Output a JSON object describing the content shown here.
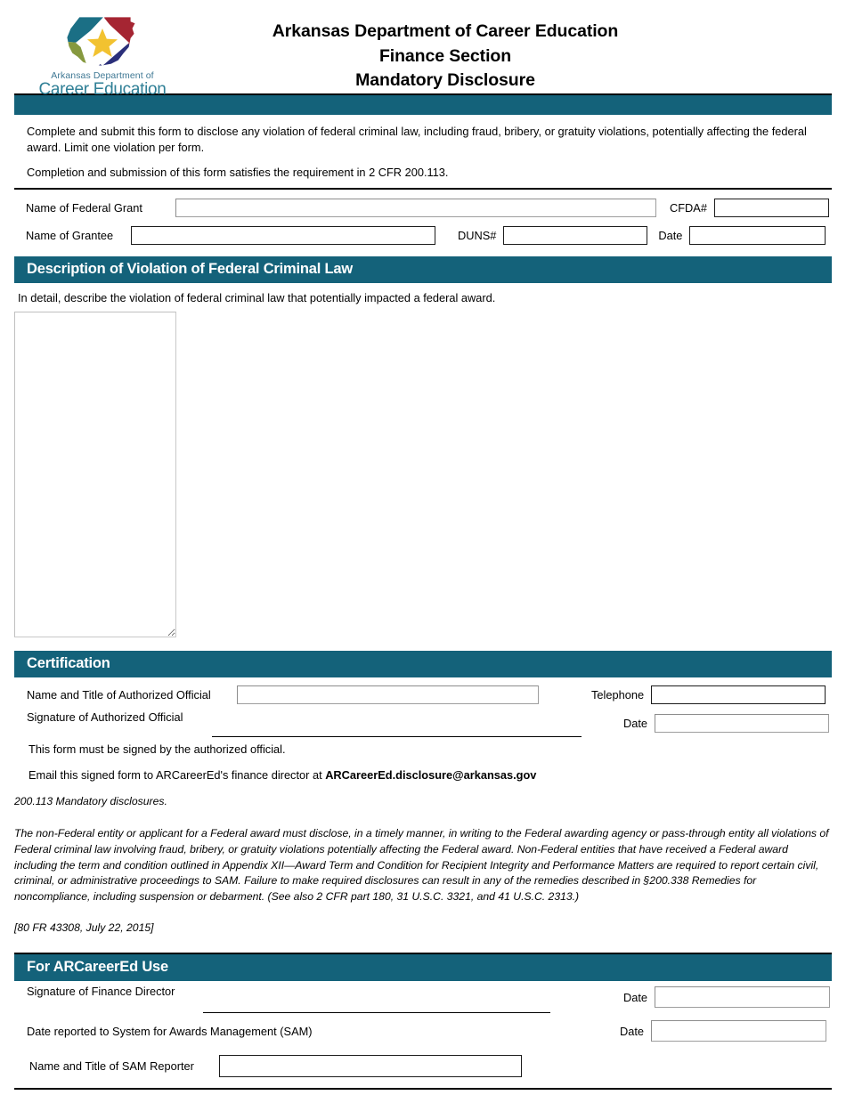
{
  "logo": {
    "line1": "Arkansas Department of",
    "line2": "Career Education",
    "icon": "arkansas-state-star-logo"
  },
  "header": {
    "title_line1": "Arkansas Department of Career Education",
    "title_line2": "Finance Section",
    "title_line3": "Mandatory  Disclosure"
  },
  "colors": {
    "teal": "#14627a",
    "logo_teal": "#2f7f96",
    "logo_red": "#a52532",
    "logo_green": "#86993f",
    "logo_navy": "#2b2f7a",
    "logo_star": "#f2c230"
  },
  "intro": {
    "paragraph1": "Complete and submit this form to disclose any violation of federal criminal law, including fraud, bribery, or gratuity violations, potentially affecting the federal award. Limit one violation per form.",
    "paragraph2": "Completion and submission of this form satisfies the requirement in 2 CFR 200.113."
  },
  "grant_fields": {
    "name_of_federal_grant_label": "Name of Federal Grant",
    "name_of_federal_grant_value": "",
    "cfda_label": "CFDA#",
    "cfda_value": "",
    "name_of_grantee_label": "Name of Grantee",
    "name_of_grantee_value": "",
    "duns_label": "DUNS#",
    "duns_value": "",
    "date_label": "Date",
    "date_value": ""
  },
  "description_section": {
    "heading": "Description of Violation of Federal Criminal Law",
    "instruction": "In detail, describe the violation of federal criminal law that potentially impacted a federal award.",
    "textarea_value": ""
  },
  "certification_section": {
    "heading": "Certification",
    "name_title_label": "Name and Title of Authorized Official",
    "name_title_value": "",
    "telephone_label": "Telephone",
    "telephone_value": "",
    "signature_label": "Signature of Authorized Official",
    "signature_value": "",
    "date_label": "Date",
    "date_value": "",
    "note_signed": "This form must be signed by the authorized official.",
    "email_prefix": "Email this signed form to ARCareerEd's finance director at ",
    "email_address": "ARCareerEd.disclosure@arkansas.gov"
  },
  "legal": {
    "lead": "200.113   Mandatory disclosures.",
    "body": "The non-Federal entity or applicant for a Federal award must disclose, in a timely manner, in writing to the Federal awarding agency or pass-through entity all violations of Federal criminal law involving fraud, bribery, or gratuity violations potentially affecting the Federal award. Non-Federal entities that have received a Federal award including the term and condition outlined in Appendix XII—Award Term and Condition for Recipient Integrity and Performance Matters are required to report certain civil, criminal, or administrative proceedings to SAM. Failure to make required disclosures can result in any of the remedies described in §200.338 Remedies for noncompliance, including suspension or debarment. (See also 2 CFR part 180, 31 U.S.C. 3321, and 41 U.S.C. 2313.)",
    "citation": "[80 FR 43308, July 22, 2015]"
  },
  "office_use_section": {
    "heading": "For ARCareerEd Use",
    "finance_director_signature_label": "Signature of Finance Director",
    "finance_director_signature_value": "",
    "finance_director_date_label": "Date",
    "finance_director_date_value": "",
    "sam_reported_label": "Date reported to System for Awards Management (SAM)",
    "sam_reported_date_label": "Date",
    "sam_reported_date_value": "",
    "sam_reporter_label": "Name and Title of SAM Reporter",
    "sam_reporter_value": ""
  }
}
